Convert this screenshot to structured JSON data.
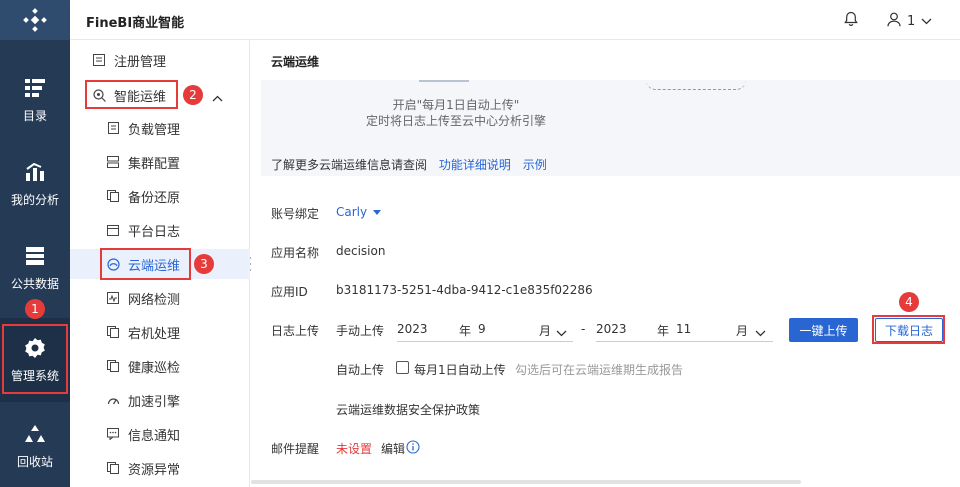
{
  "header": {
    "app_title": "FineBI商业智能",
    "user_label": "1"
  },
  "rail": {
    "items": [
      {
        "label": "目录",
        "icon": "catalog-icon"
      },
      {
        "label": "我的分析",
        "icon": "chart-icon"
      },
      {
        "label": "公共数据",
        "icon": "database-icon"
      },
      {
        "label": "管理系统",
        "icon": "gear-icon"
      },
      {
        "label": "回收站",
        "icon": "recycle-icon"
      }
    ]
  },
  "subnav": {
    "items": [
      {
        "label": "注册管理"
      },
      {
        "label": "智能运维"
      },
      {
        "label": "负载管理"
      },
      {
        "label": "集群配置"
      },
      {
        "label": "备份还原"
      },
      {
        "label": "平台日志"
      },
      {
        "label": "云端运维"
      },
      {
        "label": "网络检测"
      },
      {
        "label": "宕机处理"
      },
      {
        "label": "健康巡检"
      },
      {
        "label": "加速引擎"
      },
      {
        "label": "信息通知"
      },
      {
        "label": "资源异常"
      }
    ]
  },
  "badges": [
    "1",
    "2",
    "3",
    "4"
  ],
  "main": {
    "page_title": "云端运维",
    "banner": {
      "caption_line1": "开启\"每月1日自动上传\"",
      "caption_line2": "定时将日志上传至云中心分析引擎"
    },
    "learn_more": {
      "text": "了解更多云端运维信息请查阅",
      "link1": "功能详细说明",
      "link2": "示例"
    },
    "account": {
      "label": "账号绑定",
      "value": "Carly"
    },
    "app_name": {
      "label": "应用名称",
      "value": "decision"
    },
    "app_id": {
      "label": "应用ID",
      "value": "b3181173-5251-4dba-9412-c1e835f02286"
    },
    "log_upload": {
      "label": "日志上传",
      "manual_label": "手动上传",
      "start_year": "2023",
      "year_unit": "年",
      "start_month": "9",
      "month_unit": "月",
      "separator": "-",
      "end_year": "2023",
      "end_month": "11",
      "upload_button": "一键上传",
      "download_button": "下载日志",
      "auto_label": "自动上传",
      "auto_checkbox_label": "每月1日自动上传",
      "auto_hint": "勾选后可在云端运维期生成报告",
      "policy_link": "云端运维数据安全保护政策"
    },
    "mail": {
      "label": "邮件提醒",
      "status": "未设置",
      "edit": "编辑"
    }
  }
}
